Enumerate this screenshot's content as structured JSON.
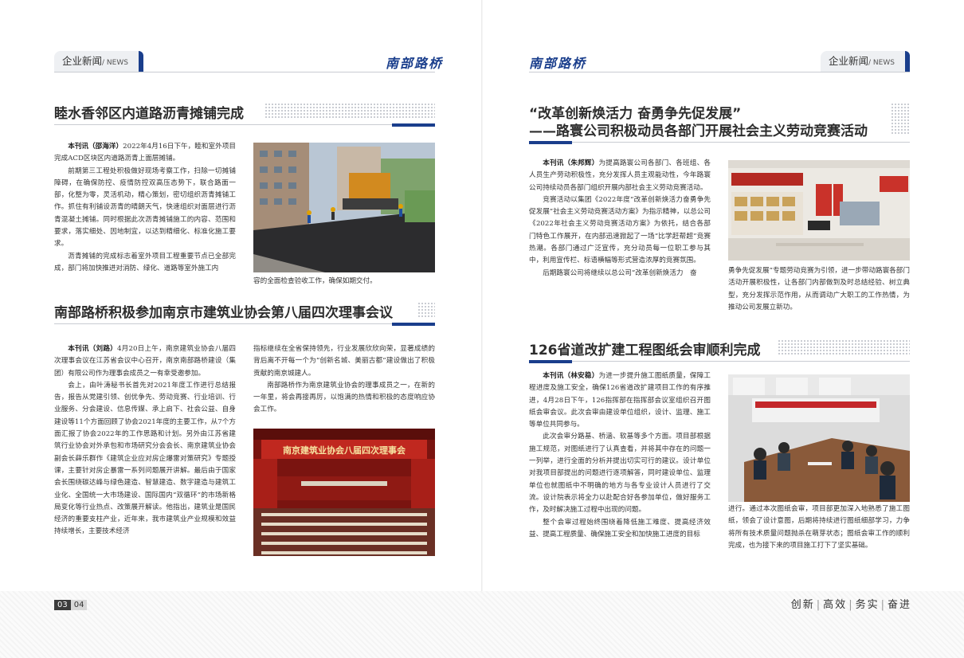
{
  "left_page": {
    "section_tab": "企业新闻",
    "section_tab_en": "/ NEWS",
    "logo_text": "南部路桥",
    "article1": {
      "title": "睦水香邻区内道路沥青摊铺完成",
      "lead_bold": "本刊讯（邵海洋）",
      "p1": "2022年4月16日下午，睦和室外项目完成ACD区块区内道路沥青上面层摊铺。",
      "p2": "前期第三工程处积极做好现场考察工作，扫除一切摊铺障碍，在确保防控、疫情防控双高压态势下，联合路面一部，化整为零，灵活机动，精心策划，密切组织沥青摊铺工作。抓住有利铺设沥青的晴朗天气，快速组织对面层进行沥青混凝土摊铺。同时根据此次沥青摊铺施工的内容、范围和要求，落实细处、因地制宜，以达到精细化、标准化施工要求。",
      "p3": "沥青摊铺的完成标志着室外项目工程重要节点已全部完成，部门将加快推进对消防、绿化、道路等室外施工内",
      "caption": "容的全面检查验收工作，确保如期交付。"
    },
    "article2": {
      "title": "南部路桥积极参加南京市建筑业协会第八届四次理事会议",
      "lead_bold": "本刊讯（刘路）",
      "p1": "4月20日上午，南京建筑业协会八届四次理事会议在江苏省会议中心召开，南京南部路桥建设（集团）有限公司作为理事会成员之一有幸受邀参加。",
      "p2": "会上，由叶涛秘书长首先对2021年度工作进行总结报告，报告从党建引领、创优争先、劳动竞赛、行业培训、行业服务、分会建设、信息传媒、承上启下、社会公益、自身建设等11个方面回顾了协会2021年度的主要工作，从7个方面汇报了协会2022年的工作思路和计划。另外由江苏省建筑行业协会对外承包和市场研究分会会长、南京建筑业协会副会长薛乐群作《建筑企业应对房企爆雷对策研究》专题授课，主要针对房企暴雷一系列问题展开讲解。最后由于国家会长围绕碳达峰与绿色建造、智慧建造、数字建造与建筑工业化、全国统一大市场建设、国际国内“双循环”的市场新格局变化等行业热点、改策展开解读。他指出，建筑业是国民经济的重要支柱产业，近年来，我市建筑业产业规模和效益持续增长，主要技术经济",
      "p3": "指标继续在全省保持领先，行业发展欣欣向荣，显著成绩的背后离不开每一个为“创新名城、美丽古都”建设做出了积极贡献的南京城建人。",
      "p4": "南部路桥作为南京建筑业协会的理事成员之一，在新的一年里，将会再接再厉，以饱满的热情和积极的态度响应协会工作。",
      "photo_banner": "南京建筑业协会八届四次理事会"
    },
    "page_numbers": [
      "03",
      "04"
    ]
  },
  "right_page": {
    "logo_text": "南部路桥",
    "section_tab": "企业新闻",
    "section_tab_en": "/ NEWS",
    "article3": {
      "title_line1": "“改革创新焕活力 奋勇争先促发展”",
      "title_line2": "——路寰公司积极动员各部门开展社会主义劳动竞赛活动",
      "lead_bold": "本刊讯（朱邦辉）",
      "p1": "为提高路寰公司各部门、各班组、各人员生产劳动积极性，充分发挥人员主观能动性，今年路寰公司持续动员各部门组织开展内部社会主义劳动竞赛活动。",
      "p2": "竞赛活动以集团《2022年度“改革创新焕活力奋勇争先促发展”社会主义劳动竞赛活动方案》为指示精神，以总公司《2022年社会主义劳动竞赛活动方案》为依托，结合各部门特色工作展开，在内部迅速掀起了一场“比学赶帮超”竞赛热潮。各部门通过广泛宣传，充分动员每一位职工参与其中，利用宣传栏、标语横幅等形式营造浓厚的竞赛氛围。",
      "p3": "后期路寰公司将继续以总公司“改革创新焕活力　奋",
      "caption": "勇争先促发展”专题劳动竞赛为引领，进一步带动路寰各部门活动开展积极性，让各部门内部做到及时总结经验、树立典型，充分发挥示范作用，从而调动广大职工的工作热情，为推动公司发展立新功。"
    },
    "article4": {
      "title": "126省道改扩建工程图纸会审顺利完成",
      "lead_bold": "本刊讯（林安稳）",
      "p1": "为进一步提升施工图纸质量，保障工程进度及施工安全，确保126省道改扩建项目工作的有序推进，4月28日下午，126指挥部在指挥部会议室组织召开图纸会审会议。此次会审由建设单位组织，设计、监理、施工等单位共同参与。",
      "p2": "此次会审分路基、桥涵、软基等多个方面。项目部根据施工规范，对图纸进行了认真查看，并将其中存在的问题一一列举，进行全面的分析并提出切实可行的建议。设计单位对我项目部提出的问题进行逐项解答，同时建设单位、监理单位也就图纸中不明确的地方与各专业设计人员进行了交流。设计院表示将全力以赴配合好各参加单位，做好服务工作，及时解决施工过程中出现的问题。",
      "p3": "整个会审过程始终围绕着降低施工难度、提高经济效益、提高工程质量、确保施工安全和加快施工进度的目标",
      "caption": "进行。通过本次图纸会审，项目部更加深入地熟悉了施工图纸，领会了设计意图，后期将持续进行图纸细部学习，力争将所有技术质量问题抛杀在萌芽状态；图纸会审工作的顺利完成，也为接下来的项目施工打下了坚实基础。"
    },
    "slogan": [
      "创新",
      "高效",
      "务实",
      "奋进"
    ]
  },
  "colors": {
    "accent": "#1a3e8c",
    "text": "#2b2b2b",
    "tab_bg": "#eef0f3"
  }
}
